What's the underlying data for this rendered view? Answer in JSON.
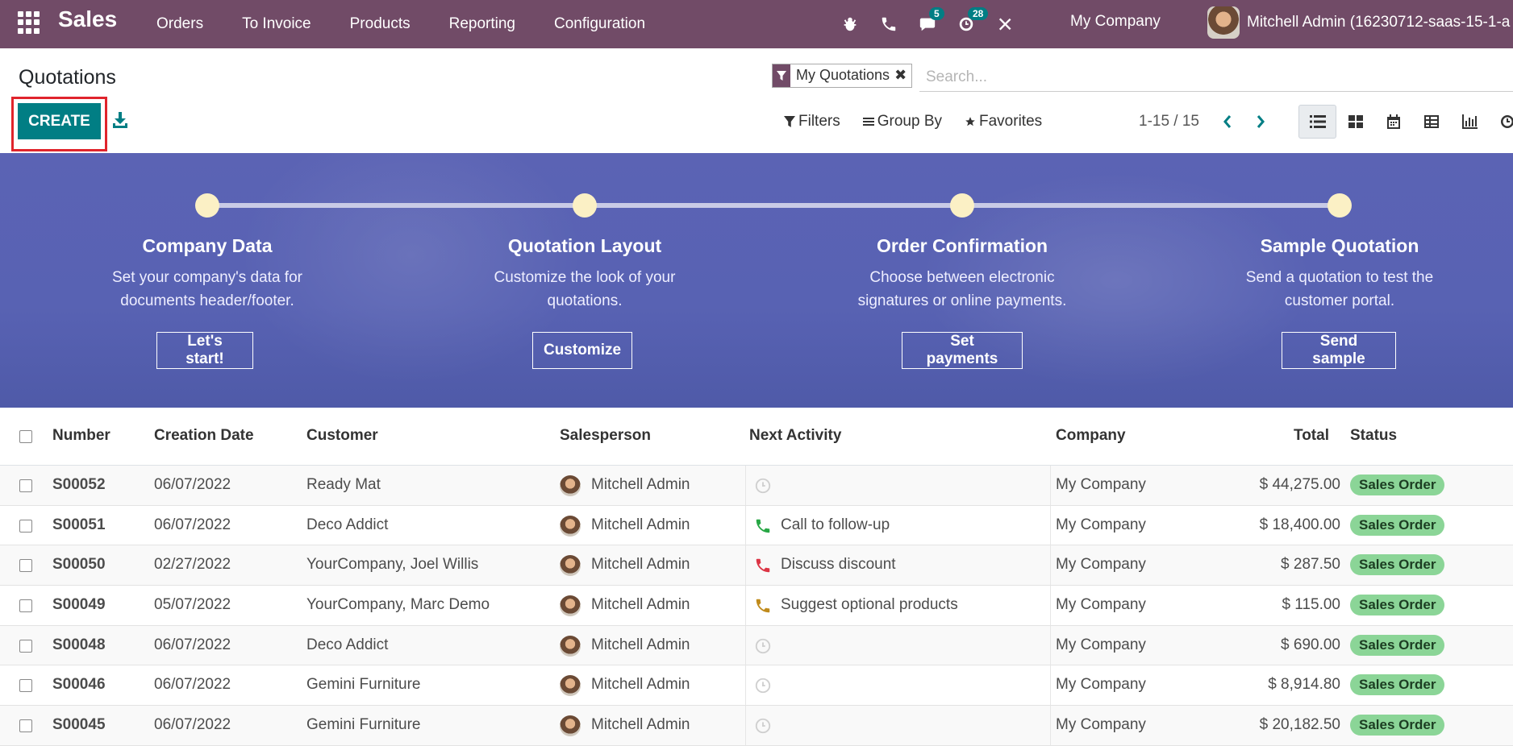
{
  "navbar": {
    "brand": "Sales",
    "menu": [
      "Orders",
      "To Invoice",
      "Products",
      "Reporting",
      "Configuration"
    ],
    "messages_count": "5",
    "activities_count": "28",
    "company": "My Company",
    "user": "Mitchell Admin (16230712-saas-15-1-a"
  },
  "control_panel": {
    "title": "Quotations",
    "create_label": "CREATE",
    "facet_label": "My Quotations",
    "search_placeholder": "Search...",
    "filters_label": "Filters",
    "group_by_label": "Group By",
    "favorites_label": "Favorites",
    "pager_value": "1-15 / 15"
  },
  "onboarding": {
    "steps": [
      {
        "title": "Company Data",
        "desc_line1": "Set your company's data for",
        "desc_line2": "documents header/footer.",
        "button": "Let's start!"
      },
      {
        "title": "Quotation Layout",
        "desc_line1": "Customize the look of your",
        "desc_line2": "quotations.",
        "button": "Customize"
      },
      {
        "title": "Order Confirmation",
        "desc_line1": "Choose between electronic",
        "desc_line2": "signatures or online payments.",
        "button": "Set payments"
      },
      {
        "title": "Sample Quotation",
        "desc_line1": "Send a quotation to test the",
        "desc_line2": "customer portal.",
        "button": "Send sample"
      }
    ]
  },
  "table": {
    "headers": {
      "number": "Number",
      "creation_date": "Creation Date",
      "customer": "Customer",
      "salesperson": "Salesperson",
      "next_activity": "Next Activity",
      "company": "Company",
      "total": "Total",
      "status": "Status"
    },
    "rows": [
      {
        "number": "S00052",
        "date": "06/07/2022",
        "customer": "Ready Mat",
        "salesperson": "Mitchell Admin",
        "activity": "",
        "activity_icon": "clock-icon",
        "company": "My Company",
        "total": "$ 44,275.00",
        "status": "Sales Order"
      },
      {
        "number": "S00051",
        "date": "06/07/2022",
        "customer": "Deco Addict",
        "salesperson": "Mitchell Admin",
        "activity": "Call to follow-up",
        "activity_icon": "phone-icon",
        "activity_color": "#28a745",
        "company": "My Company",
        "total": "$ 18,400.00",
        "status": "Sales Order"
      },
      {
        "number": "S00050",
        "date": "02/27/2022",
        "customer": "YourCompany, Joel Willis",
        "salesperson": "Mitchell Admin",
        "activity": "Discuss discount",
        "activity_icon": "phone-icon",
        "activity_color": "#dc3545",
        "company": "My Company",
        "total": "$ 287.50",
        "status": "Sales Order"
      },
      {
        "number": "S00049",
        "date": "05/07/2022",
        "customer": "YourCompany, Marc Demo",
        "salesperson": "Mitchell Admin",
        "activity": "Suggest optional products",
        "activity_icon": "phone-icon",
        "activity_color": "#c08b1c",
        "company": "My Company",
        "total": "$ 115.00",
        "status": "Sales Order"
      },
      {
        "number": "S00048",
        "date": "06/07/2022",
        "customer": "Deco Addict",
        "salesperson": "Mitchell Admin",
        "activity": "",
        "activity_icon": "clock-icon",
        "company": "My Company",
        "total": "$ 690.00",
        "status": "Sales Order"
      },
      {
        "number": "S00046",
        "date": "06/07/2022",
        "customer": "Gemini Furniture",
        "salesperson": "Mitchell Admin",
        "activity": "",
        "activity_icon": "clock-icon",
        "company": "My Company",
        "total": "$ 8,914.80",
        "status": "Sales Order"
      },
      {
        "number": "S00045",
        "date": "06/07/2022",
        "customer": "Gemini Furniture",
        "salesperson": "Mitchell Admin",
        "activity": "",
        "activity_icon": "clock-icon",
        "company": "My Company",
        "total": "$ 20,182.50",
        "status": "Sales Order"
      }
    ]
  },
  "colors": {
    "navbar": "#714b67",
    "primary": "#017e84",
    "highlight_outline": "#e0242c",
    "status_badge": "#8bd597",
    "banner": "#5b63b4"
  }
}
